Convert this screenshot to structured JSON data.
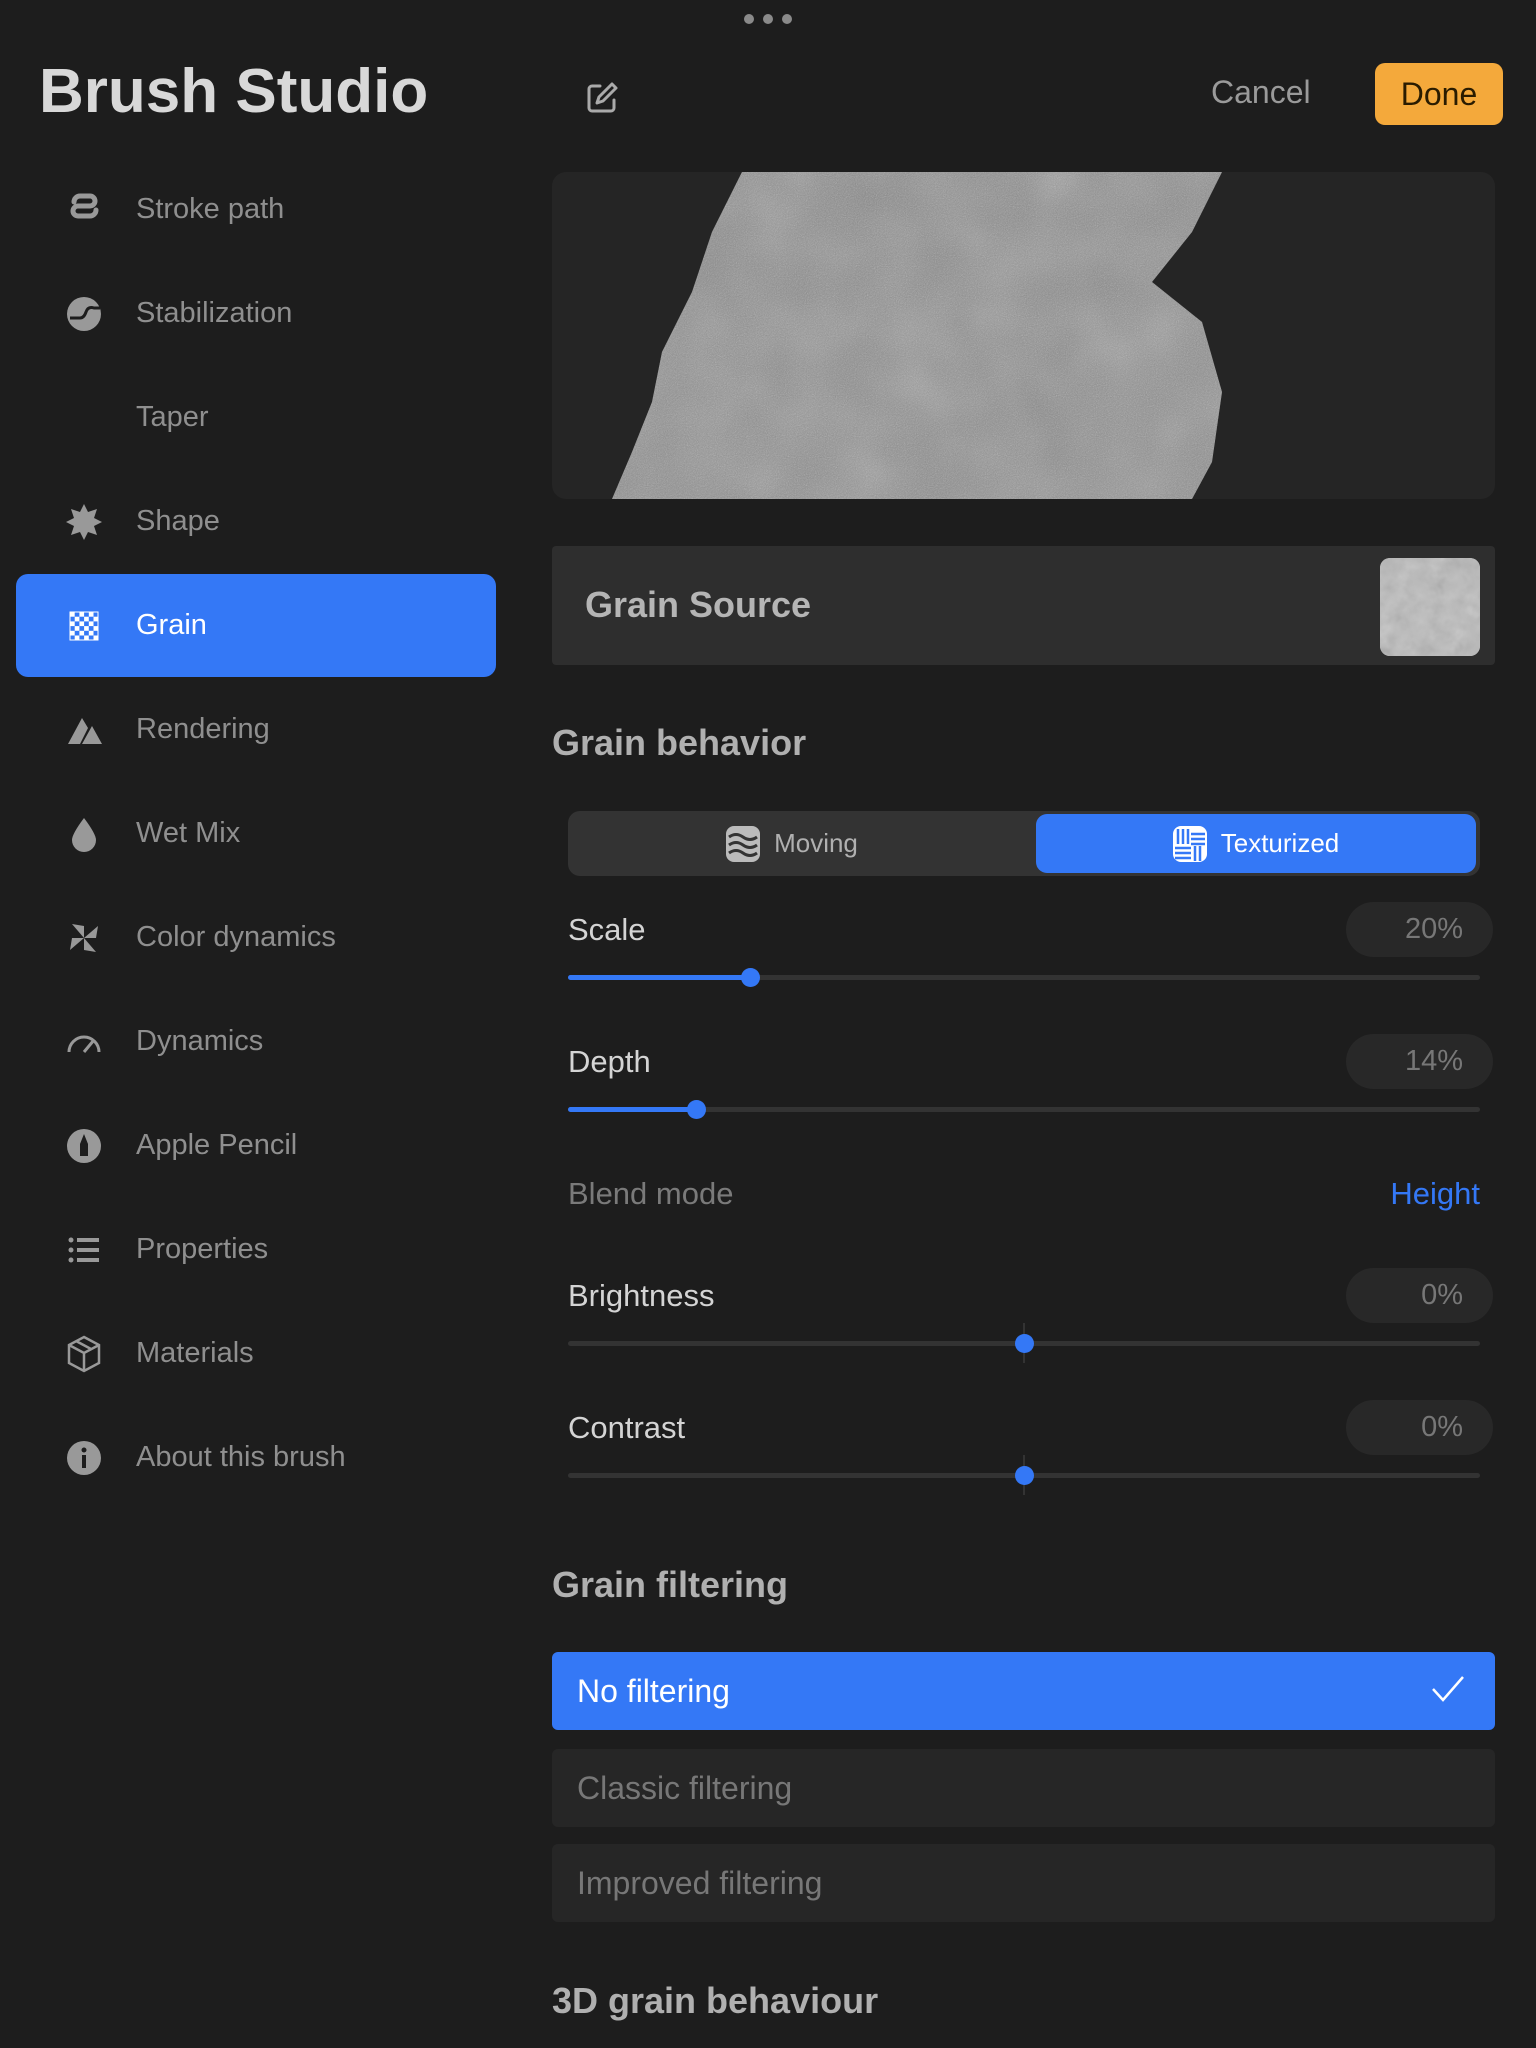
{
  "header": {
    "title": "Brush Studio",
    "cancel": "Cancel",
    "done": "Done"
  },
  "sidebar": {
    "items": [
      {
        "label": "Stroke path",
        "icon": "stroke-path-icon"
      },
      {
        "label": "Stabilization",
        "icon": "stabilization-icon"
      },
      {
        "label": "Taper",
        "icon": "taper-icon"
      },
      {
        "label": "Shape",
        "icon": "shape-icon"
      },
      {
        "label": "Grain",
        "icon": "grain-icon",
        "active": true
      },
      {
        "label": "Rendering",
        "icon": "rendering-icon"
      },
      {
        "label": "Wet Mix",
        "icon": "wet-mix-icon"
      },
      {
        "label": "Color dynamics",
        "icon": "color-dynamics-icon"
      },
      {
        "label": "Dynamics",
        "icon": "dynamics-icon"
      },
      {
        "label": "Apple Pencil",
        "icon": "apple-pencil-icon"
      },
      {
        "label": "Properties",
        "icon": "properties-icon"
      },
      {
        "label": "Materials",
        "icon": "materials-icon"
      },
      {
        "label": "About this brush",
        "icon": "info-icon"
      }
    ]
  },
  "grain_source": {
    "label": "Grain Source"
  },
  "grain_behavior": {
    "heading": "Grain behavior",
    "modes": [
      "Moving",
      "Texturized"
    ],
    "selected_mode": "Texturized",
    "scale": {
      "label": "Scale",
      "value": "20%",
      "fraction": 0.2
    },
    "depth": {
      "label": "Depth",
      "value": "14%",
      "fraction": 0.14
    },
    "blend_mode": {
      "label": "Blend mode",
      "value": "Height"
    },
    "brightness": {
      "label": "Brightness",
      "value": "0%",
      "fraction": 0.5
    },
    "contrast": {
      "label": "Contrast",
      "value": "0%",
      "fraction": 0.5
    }
  },
  "grain_filtering": {
    "heading": "Grain filtering",
    "options": [
      "No filtering",
      "Classic filtering",
      "Improved filtering"
    ],
    "selected": "No filtering"
  },
  "grain_3d": {
    "heading": "3D grain behaviour"
  },
  "colors": {
    "accent": "#3478f6",
    "done": "#f4a93b"
  }
}
